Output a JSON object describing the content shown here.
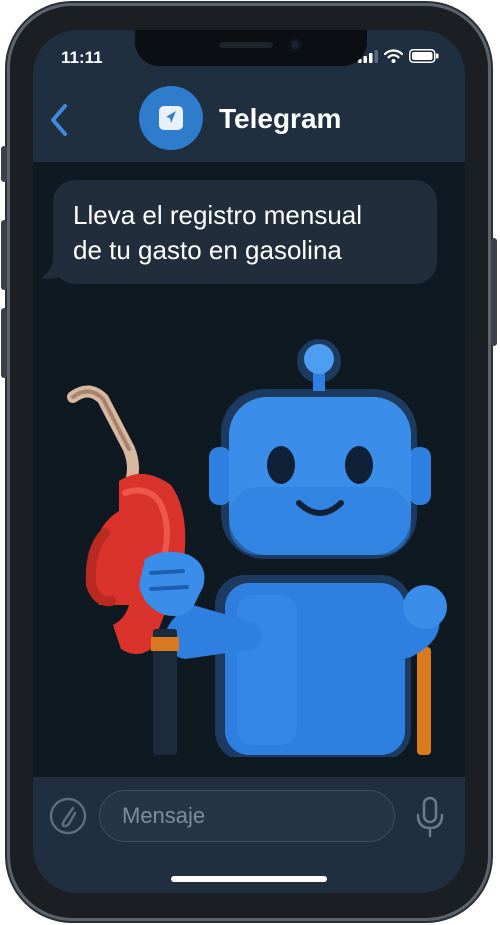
{
  "status_bar": {
    "time": "11:11",
    "icons": [
      "signal-icon",
      "wifi-icon",
      "battery-icon"
    ]
  },
  "header": {
    "back_icon": "chevron-left-icon",
    "avatar_icon": "telegram-plane-icon",
    "title": "Telegram"
  },
  "chat": {
    "message_line1": "Lleva el registro mensual",
    "message_line2": "de tu gasto en gasolina",
    "illustration": "robot-holding-fuel-nozzle"
  },
  "input_bar": {
    "attach_icon": "paperclip-icon",
    "placeholder": "Mensaje",
    "mic_icon": "microphone-icon"
  },
  "colors": {
    "header_bg": "#1f2f40",
    "chat_bg": "#0f1922",
    "bubble_bg": "#212d3a",
    "accent": "#3d8bd9",
    "robot_blue": "#2f7fe0",
    "nozzle_red": "#d9332b"
  }
}
